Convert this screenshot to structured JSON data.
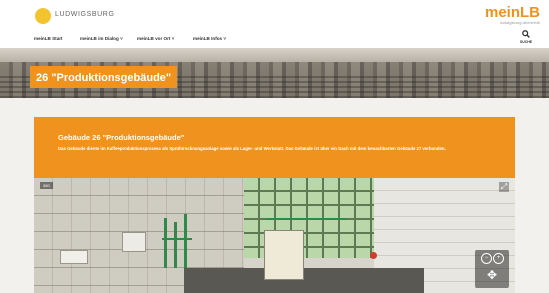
{
  "header": {
    "city_logo_text": "LUDWIGSBURG",
    "brand_name": "meinLB",
    "brand_tagline": "ludwigsburg.de/meinlb",
    "search_label": "SUCHE"
  },
  "nav": {
    "items": [
      {
        "label": "meinLB Start"
      },
      {
        "label": "meinLB im Dialog ˅"
      },
      {
        "label": "meinLB vor Ort ˅"
      },
      {
        "label": "meinLB Infos ˅"
      }
    ]
  },
  "hero": {
    "title": "26 \"Produktionsgebäude\""
  },
  "card": {
    "title": "Gebäude 26 \"Produktionsgebäude\"",
    "text": "Das Gebäude diente im Kaffeeproduktionsprozess als Sprühtrocknungsanlage sowie als Lager- und Werkstatt. Das Gebäude ist über ein Dach mit dem benachbarten Gebäude 27 verbunden."
  },
  "panorama": {
    "badge": "360",
    "zoom_in": "+",
    "zoom_out": "−",
    "control_glyph": "✥",
    "expand_glyph": "⤢"
  },
  "colors": {
    "accent": "#f0931e",
    "logo_yellow": "#f4c430",
    "content_bg": "#f3f1ee"
  },
  "icons": [
    "ludwigsburg-logo-icon",
    "search-icon",
    "expand-icon",
    "zoom-in-icon",
    "zoom-out-icon",
    "pan-control-icon"
  ]
}
